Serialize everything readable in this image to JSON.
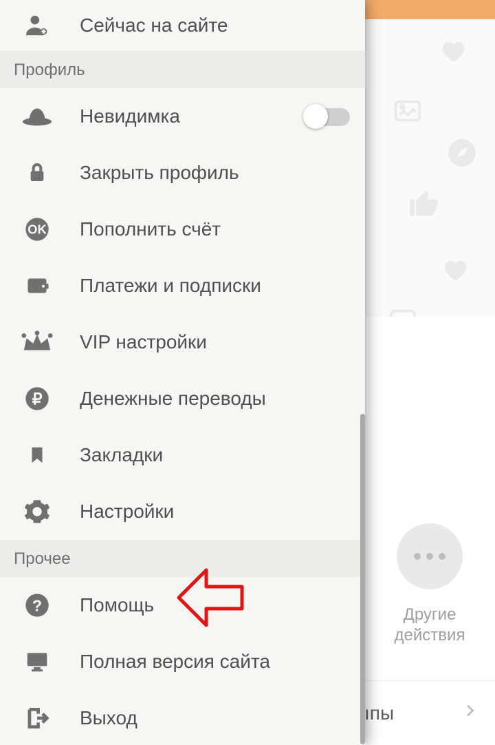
{
  "drawer": {
    "top_item": {
      "label": "Сейчас на сайте"
    },
    "sections": {
      "profile": {
        "title": "Профиль",
        "items": {
          "invisible": {
            "label": "Невидимка"
          },
          "close_profile": {
            "label": "Закрыть профиль"
          },
          "topup": {
            "label": "Пополнить счёт"
          },
          "payments": {
            "label": "Платежи и подписки"
          },
          "vip": {
            "label": "VIP настройки"
          },
          "transfers": {
            "label": "Денежные переводы"
          },
          "bookmarks": {
            "label": "Закладки"
          },
          "settings": {
            "label": "Настройки"
          }
        }
      },
      "other": {
        "title": "Прочее",
        "items": {
          "help": {
            "label": "Помощь"
          },
          "desktop": {
            "label": "Полная версия сайта"
          },
          "logout": {
            "label": "Выход"
          }
        }
      }
    }
  },
  "right_panel": {
    "other_actions_line1": "Другие",
    "other_actions_line2": "действия",
    "bottom_row_fragment": "ıпы"
  },
  "toggle": {
    "invisible_on": false
  }
}
